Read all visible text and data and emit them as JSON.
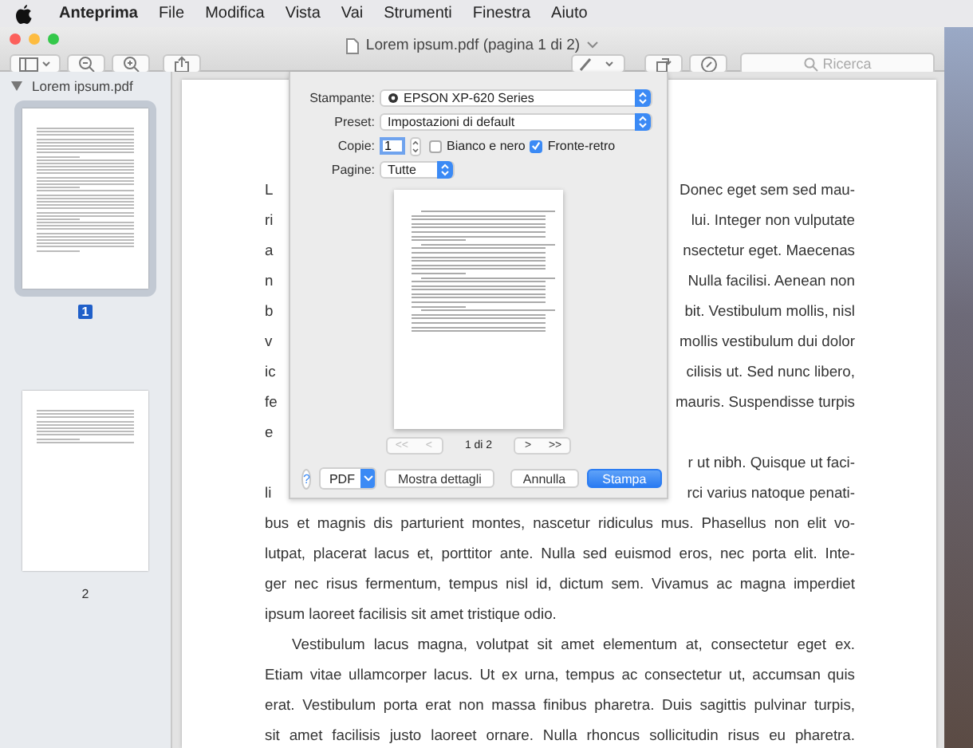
{
  "menu_bar": {
    "app": "Anteprima",
    "items": [
      "File",
      "Modifica",
      "Vista",
      "Vai",
      "Strumenti",
      "Finestra",
      "Aiuto"
    ]
  },
  "window": {
    "title": "Lorem ipsum.pdf (pagina 1 di 2)",
    "search": {
      "placeholder": "Ricerca"
    }
  },
  "sidebar": {
    "document": "Lorem ipsum.pdf",
    "expanded": true,
    "pages": [
      {
        "label": "1",
        "selected": true
      },
      {
        "label": "2",
        "selected": false
      }
    ]
  },
  "document": {
    "lines": [
      {
        "kind": "split",
        "left": "L",
        "right": "Donec eget sem sed mau-"
      },
      {
        "kind": "split",
        "left": "ri",
        "right": "lui. Integer non vulputate"
      },
      {
        "kind": "split",
        "left": "a",
        "right": "nsectetur eget. Maecenas"
      },
      {
        "kind": "split",
        "left": "n",
        "right": "Nulla facilisi. Aenean non"
      },
      {
        "kind": "split",
        "left": "b",
        "right": "bit. Vestibulum mollis, nisl"
      },
      {
        "kind": "split",
        "left": "v",
        "right": "mollis vestibulum dui dolor"
      },
      {
        "kind": "split",
        "left": "ic",
        "right": "cilisis ut. Sed nunc libero,"
      },
      {
        "kind": "split",
        "left": "fe",
        "right": "mauris. Suspendisse turpis"
      },
      {
        "kind": "split",
        "left": "e"
      },
      {
        "kind": "split",
        "right": "r ut nibh. Quisque ut faci-"
      },
      {
        "kind": "split",
        "left": "li",
        "right": "rci varius natoque penati-"
      },
      {
        "kind": "full",
        "text": "bus et magnis dis parturient montes, nascetur ridiculus mus. Phasellus non elit vo-"
      },
      {
        "kind": "full",
        "text": "lutpat, placerat lacus et, porttitor ante. Nulla sed euismod eros, nec porta elit. Inte-"
      },
      {
        "kind": "full",
        "text": "ger nec risus fermentum, tempus nisl id, dictum sem. Vivamus ac magna imperdiet"
      },
      {
        "kind": "last",
        "text": "ipsum laoreet facilisis sit amet tristique odio."
      },
      {
        "kind": "first",
        "text": "Vestibulum lacus magna, volutpat sit amet elementum at, consectetur eget ex."
      },
      {
        "kind": "full",
        "text": "Etiam vitae ullamcorper lacus. Ut ex urna, tempus ac consectetur ut, accumsan quis"
      },
      {
        "kind": "full",
        "text": "erat. Vestibulum porta erat non massa finibus pharetra. Duis sagittis pulvinar turpis,"
      },
      {
        "kind": "full",
        "text": "sit amet facilisis justo laoreet ornare. Nulla rhoncus sollicitudin risus eu pharetra."
      }
    ]
  },
  "print_dialog": {
    "printer": {
      "label": "Stampante:",
      "value": "EPSON XP-620 Series"
    },
    "preset": {
      "label": "Preset:",
      "value": "Impostazioni di default"
    },
    "copies": {
      "label": "Copie:",
      "value": "1"
    },
    "options": [
      {
        "label": "Bianco e nero",
        "checked": false
      },
      {
        "label": "Fronte-retro",
        "checked": true
      }
    ],
    "pages": {
      "label": "Pagine:",
      "value": "Tutte"
    },
    "nav_back": [
      {
        "label": "<<",
        "disabled": true
      },
      {
        "label": "<",
        "disabled": true
      }
    ],
    "page_indicator": "1 di 2",
    "nav_forward": [
      {
        "label": ">",
        "disabled": false
      },
      {
        "label": ">>",
        "disabled": false
      }
    ],
    "help": "?",
    "pdf": "PDF",
    "buttons": [
      {
        "label": "Mostra dettagli",
        "kind": "plain"
      },
      {
        "label": "Annulla",
        "kind": "plain"
      },
      {
        "label": "Stampa",
        "kind": "default"
      }
    ]
  }
}
